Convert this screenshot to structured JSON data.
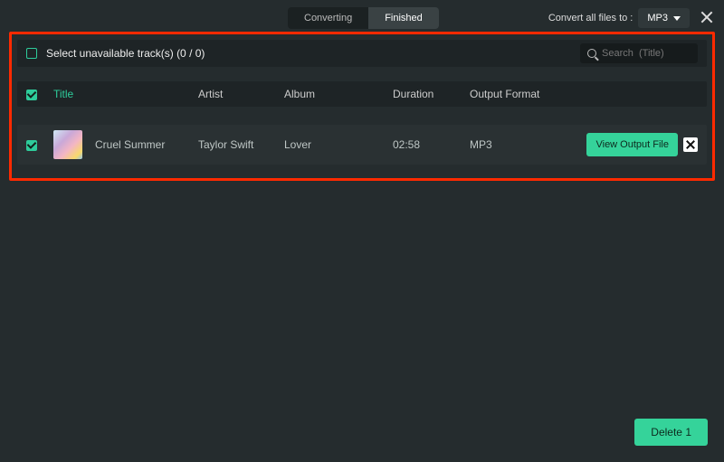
{
  "header": {
    "tabs": [
      {
        "label": "Converting",
        "active": false
      },
      {
        "label": "Finished",
        "active": true
      }
    ],
    "convert_label": "Convert all files to :",
    "convert_value": "MP3"
  },
  "unavailable_bar": {
    "label": "Select unavailable track(s) (0 / 0)"
  },
  "search": {
    "placeholder": "Search  (Title)"
  },
  "columns": {
    "title": "Title",
    "artist": "Artist",
    "album": "Album",
    "duration": "Duration",
    "format": "Output Format"
  },
  "rows": [
    {
      "title": "Cruel Summer",
      "artist": "Taylor Swift",
      "album": "Lover",
      "duration": "02:58",
      "format": "MP3",
      "action_label": "View Output File"
    }
  ],
  "footer": {
    "delete_label": "Delete 1"
  }
}
